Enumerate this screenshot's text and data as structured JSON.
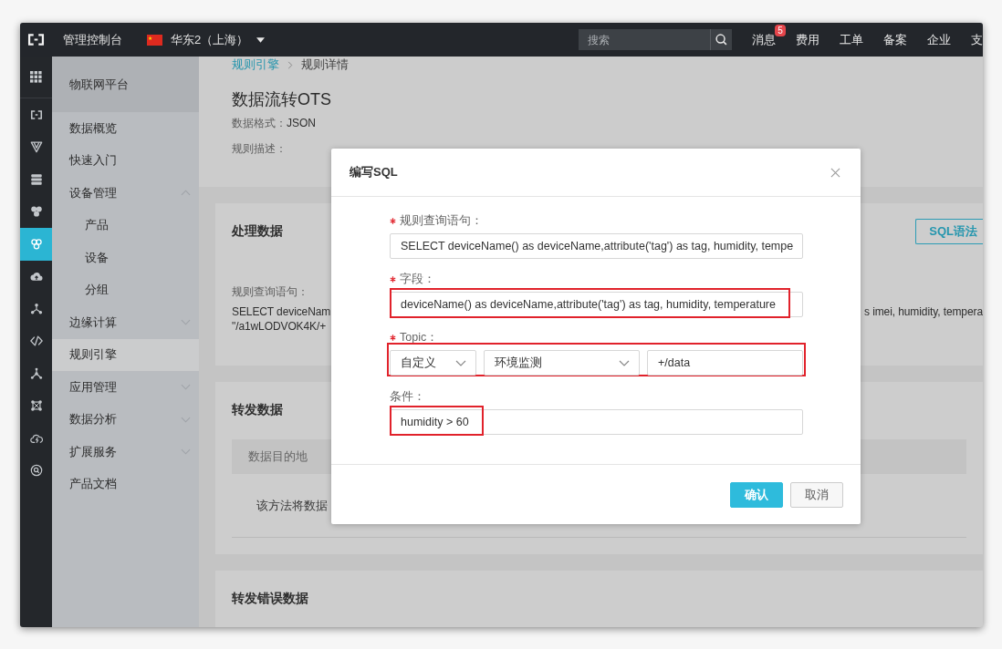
{
  "top_bar": {
    "title": "管理控制台",
    "region": "华东2（上海）",
    "search": {
      "placeholder": "搜索"
    },
    "nav": [
      {
        "label": "消息",
        "badge": "5"
      },
      {
        "label": "费用"
      },
      {
        "label": "工单"
      },
      {
        "label": "备案"
      },
      {
        "label": "企业"
      },
      {
        "label": "支"
      }
    ]
  },
  "icon_rail": [
    {
      "selected": false
    },
    {
      "selected": false
    },
    {
      "selected": false
    },
    {
      "selected": false
    },
    {
      "selected": true
    },
    {
      "selected": false
    },
    {
      "selected": false
    },
    {
      "selected": false
    },
    {
      "selected": false
    },
    {
      "selected": false
    },
    {
      "selected": false
    },
    {
      "selected": false
    }
  ],
  "sidebar": {
    "title": "物联网平台",
    "items": [
      {
        "label": "数据概览",
        "kind": "page",
        "selected": false
      },
      {
        "label": "快速入门",
        "kind": "page",
        "selected": false
      },
      {
        "label": "设备管理",
        "kind": "group",
        "expanded": true,
        "selected": false,
        "children": [
          {
            "label": "产品",
            "selected": false
          },
          {
            "label": "设备",
            "selected": false
          },
          {
            "label": "分组",
            "selected": false
          }
        ]
      },
      {
        "label": "边缘计算",
        "kind": "group",
        "expanded": false,
        "selected": false
      },
      {
        "label": "规则引擎",
        "kind": "page",
        "selected": true
      },
      {
        "label": "应用管理",
        "kind": "group",
        "expanded": false,
        "selected": false
      },
      {
        "label": "数据分析",
        "kind": "group",
        "expanded": false,
        "selected": false
      },
      {
        "label": "扩展服务",
        "kind": "group",
        "expanded": false,
        "selected": false
      },
      {
        "label": "产品文档",
        "kind": "page",
        "selected": false
      }
    ]
  },
  "breadcrumb": [
    {
      "label": "规则引擎",
      "kind": "link"
    },
    {
      "label": "规则详情",
      "kind": "current"
    }
  ],
  "page": {
    "title": "数据流转OTS",
    "meta": [
      {
        "label": "数据格式：",
        "value": "JSON"
      },
      {
        "label": "规则描述："
      }
    ]
  },
  "process_data": {
    "title": "处理数据",
    "button": "SQL语法",
    "query_label": "规则查询语句：",
    "query_line_1_start": "SELECT deviceNam",
    "query_line_1_end": "s imei, humidity, tempera",
    "query_line_2": "\"/a1wLODVOK4K/+"
  },
  "forward_data": {
    "title": "转发数据",
    "table_header": "数据目的地",
    "row_text": "该方法将数据"
  },
  "forward_errors": {
    "title": "转发错误数据"
  },
  "modal": {
    "title": "编写SQL",
    "fields": [
      {
        "kind": "input",
        "label": "规则查询语句：",
        "required": true,
        "value": "SELECT deviceName() as deviceName,attribute('tag') as tag, humidity, tempe",
        "highlighted": false
      },
      {
        "kind": "input",
        "label": "字段：",
        "required": true,
        "value": "deviceName() as deviceName,attribute('tag') as tag, humidity, temperature",
        "highlighted": true
      },
      {
        "kind": "topic",
        "label": "Topic：",
        "required": true,
        "highlighted": true,
        "parts": [
          {
            "kind": "select",
            "value": "自定义"
          },
          {
            "kind": "select",
            "value": "环境监测"
          },
          {
            "kind": "input",
            "value": "+/data"
          }
        ]
      },
      {
        "kind": "input",
        "label": "条件：",
        "required": false,
        "value": "humidity > 60",
        "highlighted": true
      }
    ],
    "buttons": [
      {
        "label": "确认",
        "kind": "primary"
      },
      {
        "label": "取消",
        "kind": "default"
      }
    ]
  }
}
